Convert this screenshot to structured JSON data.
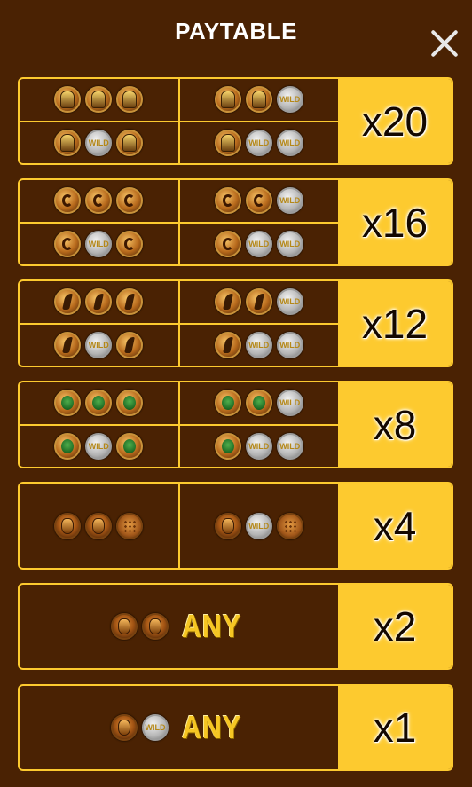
{
  "title": "PAYTABLE",
  "close_icon": "close-icon",
  "colors": {
    "background": "#4a2203",
    "accent": "#fdca2f",
    "title": "#ffffff"
  },
  "rows": [
    {
      "multiplier": "x20",
      "cells": [
        [
          "pharaoh",
          "pharaoh",
          "pharaoh"
        ],
        [
          "pharaoh",
          "wild",
          "pharaoh"
        ],
        [
          "pharaoh",
          "pharaoh",
          "wild"
        ],
        [
          "pharaoh",
          "wild",
          "wild"
        ]
      ]
    },
    {
      "multiplier": "x16",
      "cells": [
        [
          "ra",
          "ra",
          "ra"
        ],
        [
          "ra",
          "wild",
          "ra"
        ],
        [
          "ra",
          "ra",
          "wild"
        ],
        [
          "ra",
          "wild",
          "wild"
        ]
      ]
    },
    {
      "multiplier": "x12",
      "cells": [
        [
          "anubis",
          "anubis",
          "anubis"
        ],
        [
          "anubis",
          "wild",
          "anubis"
        ],
        [
          "anubis",
          "anubis",
          "wild"
        ],
        [
          "anubis",
          "wild",
          "wild"
        ]
      ]
    },
    {
      "multiplier": "x8",
      "cells": [
        [
          "scarab",
          "scarab",
          "scarab"
        ],
        [
          "scarab",
          "wild",
          "scarab"
        ],
        [
          "scarab",
          "scarab",
          "wild"
        ],
        [
          "scarab",
          "wild",
          "wild"
        ]
      ]
    },
    {
      "multiplier": "x4",
      "cells": [
        [
          "vase",
          "vase",
          "grid"
        ],
        [
          "vase",
          "wild",
          "grid"
        ]
      ]
    },
    {
      "multiplier": "x2",
      "any_text": "ANY",
      "symbols": [
        "vase",
        "vase"
      ]
    },
    {
      "multiplier": "x1",
      "any_text": "ANY",
      "symbols": [
        "vase",
        "wild"
      ]
    }
  ],
  "wild_text": "WILD"
}
